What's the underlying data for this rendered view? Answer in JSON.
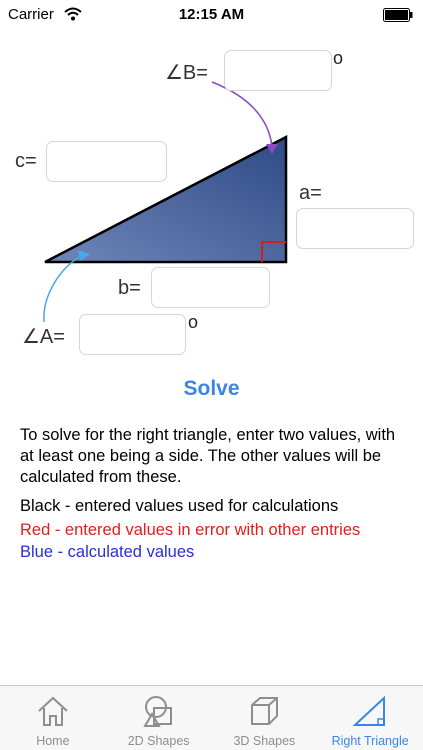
{
  "status_bar": {
    "carrier": "Carrier",
    "time": "12:15 AM"
  },
  "labels": {
    "angle_b": "∠B=",
    "angle_a": "∠A=",
    "side_c": "c=",
    "side_a": "a=",
    "side_b": "b=",
    "degree_mark": "o"
  },
  "inputs": {
    "angle_b": {
      "value": "",
      "placeholder": ""
    },
    "side_c": {
      "value": "",
      "placeholder": ""
    },
    "side_a": {
      "value": "",
      "placeholder": ""
    },
    "side_b": {
      "value": "",
      "placeholder": ""
    },
    "angle_a": {
      "value": "",
      "placeholder": ""
    }
  },
  "solve_label": "Solve",
  "instructions": "To solve for the right triangle, enter two values, with at least one being a side.  The other values will be calculated from these.",
  "legend": {
    "black": "Black - entered values used for calculations",
    "red": "Red - entered values in error with other entries",
    "blue": "Blue - calculated values"
  },
  "colors": {
    "accent": "#3a85e6",
    "triangle_fill": "#3f5b97",
    "error": "#e0201a",
    "calculated": "#2a2fd0"
  },
  "tabs": [
    {
      "label": "Home",
      "icon": "home-icon",
      "active": false
    },
    {
      "label": "2D Shapes",
      "icon": "shapes-2d-icon",
      "active": false
    },
    {
      "label": "3D Shapes",
      "icon": "cube-icon",
      "active": false
    },
    {
      "label": "Right Triangle",
      "icon": "right-triangle-icon",
      "active": true
    }
  ]
}
